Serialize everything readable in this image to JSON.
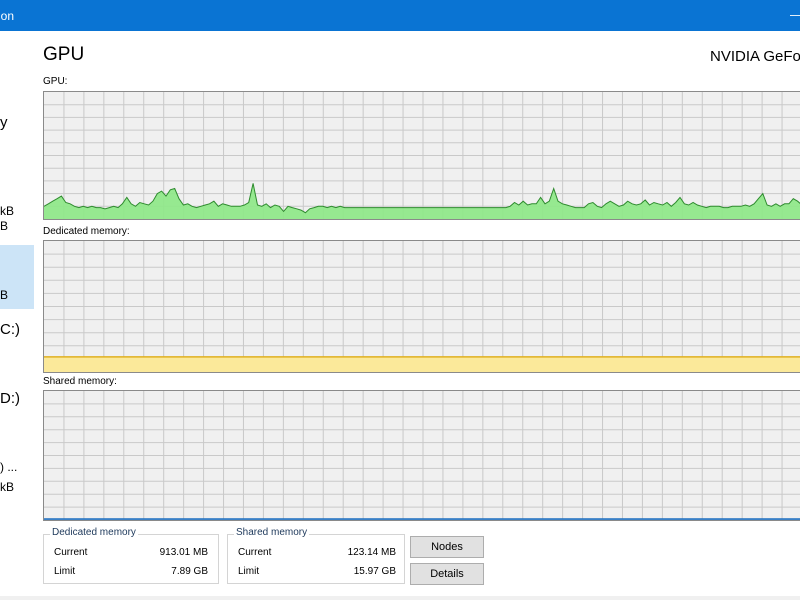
{
  "window": {
    "title": "ion",
    "minimize_glyph": "—"
  },
  "sidebar": {
    "items": [
      {
        "label": "y"
      },
      {
        "label": "kB"
      },
      {
        "label": "B"
      },
      {
        "label": "B"
      },
      {
        "label": "C:)"
      },
      {
        "label": "D:)"
      },
      {
        "label": ") ..."
      },
      {
        "label": "kB"
      }
    ]
  },
  "header": {
    "title": "GPU",
    "device": "NVIDIA GeFo"
  },
  "graphs": {
    "gpu_label": "GPU:",
    "dedicated_label": "Dedicated memory:",
    "shared_label": "Shared memory:"
  },
  "chart_data": [
    {
      "type": "area",
      "label": "GPU:",
      "color": "#90e88a",
      "line_color": "#2e8b2e",
      "ylim": [
        0,
        100
      ],
      "grid": true,
      "values": [
        10,
        12,
        14,
        16,
        18,
        13,
        12,
        10,
        9,
        10,
        9,
        10,
        9,
        9,
        8,
        9,
        10,
        9,
        12,
        17,
        12,
        10,
        13,
        12,
        11,
        14,
        20,
        22,
        18,
        23,
        24,
        16,
        11,
        12,
        10,
        9,
        10,
        11,
        12,
        14,
        10,
        12,
        11,
        10,
        10,
        10,
        11,
        13,
        28,
        11,
        10,
        12,
        9,
        11,
        10,
        6,
        10,
        9,
        8,
        7,
        5,
        8,
        9,
        10,
        10,
        9,
        10,
        9,
        10,
        9,
        9,
        9,
        9,
        9,
        9,
        9,
        9,
        9,
        9,
        9,
        9,
        9,
        9,
        9,
        9,
        9,
        9,
        9,
        9,
        9,
        9,
        9,
        9,
        9,
        9,
        9,
        9,
        9,
        9,
        9,
        9,
        9,
        9,
        9,
        9,
        9,
        9,
        10,
        13,
        11,
        14,
        11,
        12,
        12,
        17,
        12,
        14,
        24,
        14,
        12,
        11,
        10,
        9,
        9,
        9,
        12,
        13,
        10,
        9,
        12,
        14,
        12,
        10,
        11,
        14,
        12,
        11,
        12,
        15,
        11,
        13,
        12,
        11,
        13,
        10,
        13,
        17,
        12,
        11,
        13,
        11,
        10,
        9,
        10,
        10,
        10,
        9,
        9,
        10,
        10,
        10,
        11,
        10,
        12,
        16,
        20,
        11,
        10,
        12,
        10,
        12,
        12,
        16,
        14,
        11
      ],
      "title": "",
      "xlabel": "",
      "ylabel": ""
    },
    {
      "type": "area",
      "label": "Dedicated memory:",
      "color": "#fbe99a",
      "line_color": "#e0b020",
      "ylim": [
        0,
        7.89
      ],
      "unit": "GB",
      "value": 0.913,
      "grid": true,
      "title": "",
      "xlabel": "",
      "ylabel": ""
    },
    {
      "type": "area",
      "label": "Shared memory:",
      "color": "#8ab4de",
      "line_color": "#1e6fbf",
      "ylim": [
        0,
        15.97
      ],
      "unit": "GB",
      "value": 0.123,
      "grid": true,
      "title": "",
      "xlabel": "",
      "ylabel": ""
    }
  ],
  "stats": {
    "dedicated": {
      "title": "Dedicated memory",
      "current_label": "Current",
      "current_value": "913.01 MB",
      "limit_label": "Limit",
      "limit_value": "7.89 GB"
    },
    "shared": {
      "title": "Shared memory",
      "current_label": "Current",
      "current_value": "123.14 MB",
      "limit_label": "Limit",
      "limit_value": "15.97 GB"
    }
  },
  "buttons": {
    "nodes": "Nodes",
    "details": "Details"
  }
}
